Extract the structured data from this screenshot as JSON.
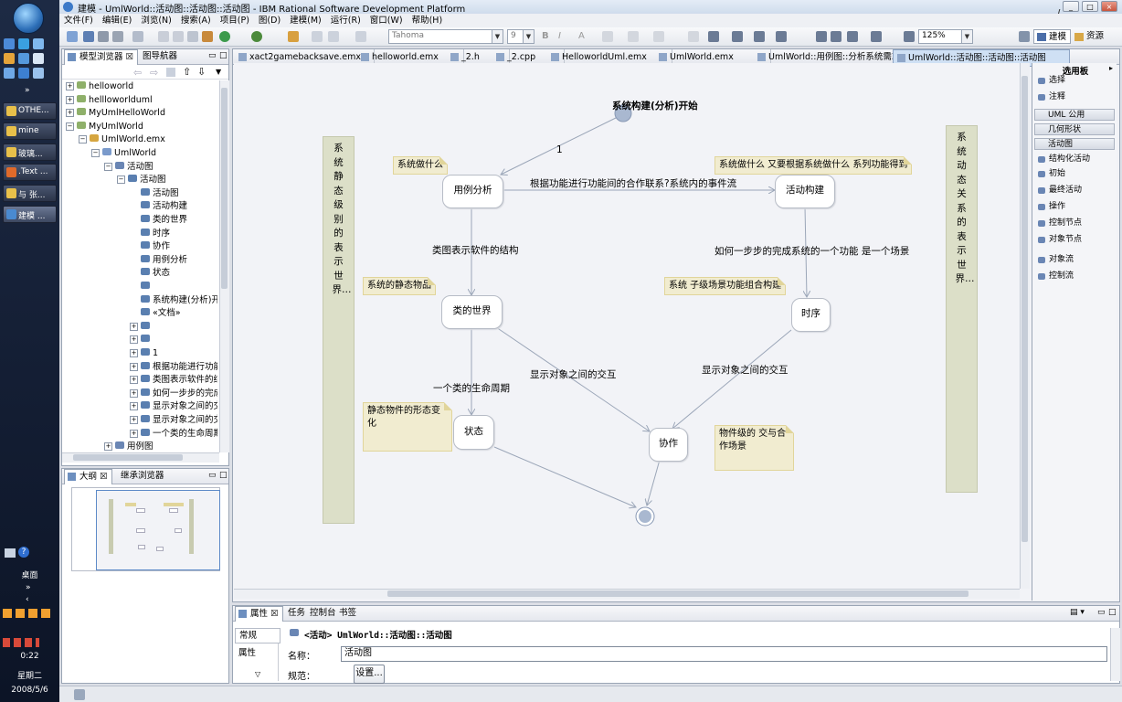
{
  "window": {
    "title": "建模 - UmlWorld::活动图::活动图::活动图 - IBM Rational Software Development Platform",
    "controls": [
      "_",
      "□",
      "×"
    ]
  },
  "menu": [
    "文件(F)",
    "编辑(E)",
    "浏览(N)",
    "搜索(A)",
    "项目(P)",
    "图(D)",
    "建模(M)",
    "运行(R)",
    "窗口(W)",
    "帮助(H)"
  ],
  "toolbar": {
    "font": "Tahoma",
    "size": "9",
    "bold": "B",
    "italic": "I",
    "font_color": "A",
    "zoom": "125%",
    "perspectives": [
      "建模",
      "资源"
    ]
  },
  "taskbar": {
    "items": [
      "OTHE...",
      "mine",
      "玻璃...",
      ".Text ...",
      "与 张...",
      "建模 ..."
    ],
    "desktop": "桌面",
    "time": "0:22",
    "weekday": "星期二",
    "date": "2008/5/6"
  },
  "model_explorer": {
    "tabs": [
      "模型浏览器",
      "图导航器"
    ],
    "tree": [
      {
        "label": "helloworld",
        "indent": 0,
        "exp": "+"
      },
      {
        "label": "hellloworlduml",
        "indent": 0,
        "exp": "+"
      },
      {
        "label": "MyUmlHelloWorld",
        "indent": 0,
        "exp": "+"
      },
      {
        "label": "MyUmlWorld",
        "indent": 0,
        "exp": "−"
      },
      {
        "label": "UmlWorld.emx",
        "indent": 1,
        "exp": "−"
      },
      {
        "label": "UmlWorld",
        "indent": 2,
        "exp": "−"
      },
      {
        "label": "活动图",
        "indent": 3,
        "exp": "−"
      },
      {
        "label": "活动图",
        "indent": 4,
        "exp": "−"
      },
      {
        "label": "活动图",
        "indent": 5,
        "exp": ""
      },
      {
        "label": "活动构建",
        "indent": 5,
        "exp": ""
      },
      {
        "label": "类的世界",
        "indent": 5,
        "exp": ""
      },
      {
        "label": "时序",
        "indent": 5,
        "exp": ""
      },
      {
        "label": "协作",
        "indent": 5,
        "exp": ""
      },
      {
        "label": "用例分析",
        "indent": 5,
        "exp": ""
      },
      {
        "label": "状态",
        "indent": 5,
        "exp": ""
      },
      {
        "label": "",
        "indent": 5,
        "exp": ""
      },
      {
        "label": "系统构建(分析)开",
        "indent": 5,
        "exp": ""
      },
      {
        "label": "«文档»",
        "indent": 5,
        "exp": ""
      },
      {
        "label": "",
        "indent": 5,
        "exp": "+"
      },
      {
        "label": "",
        "indent": 5,
        "exp": "+"
      },
      {
        "label": "1",
        "indent": 5,
        "exp": "+"
      },
      {
        "label": "根据功能进行功能",
        "indent": 5,
        "exp": "+"
      },
      {
        "label": "类图表示软件的结",
        "indent": 5,
        "exp": "+"
      },
      {
        "label": "如何一步步的完成",
        "indent": 5,
        "exp": "+"
      },
      {
        "label": "显示对象之间的交",
        "indent": 5,
        "exp": "+"
      },
      {
        "label": "显示对象之间的交",
        "indent": 5,
        "exp": "+"
      },
      {
        "label": "一个类的生命周期",
        "indent": 5,
        "exp": "+"
      },
      {
        "label": "用例图",
        "indent": 3,
        "exp": "+"
      }
    ]
  },
  "outline": {
    "tabs": [
      "大纲",
      "继承浏览器"
    ]
  },
  "editor": {
    "tabs": [
      "xact2gamebacksave.emx",
      "helloworld.emx",
      "_2.h",
      "_2.cpp",
      "HelloworldUml.emx",
      "UmlWorld.emx",
      "UmlWorld::用例图::分析系统需求",
      "UmlWorld::活动图::活动图::活动图"
    ],
    "selected_tab": 7
  },
  "diagram": {
    "start_label": "系统构建(分析)开始",
    "multiplicity": "1",
    "activities": {
      "usecase": "用例分析",
      "build": "活动构建",
      "classes": "类的世界",
      "sequence": "时序",
      "state": "状态",
      "collab": "协作"
    },
    "notes": {
      "what": "系统做什么",
      "how": "系统做什么 又要根据系统做什么 系列功能得到",
      "static_items": "系统的静态物品",
      "subsystem": "系统 子级场景功能组合构建",
      "static_change": "静态物件的形态变化",
      "object_level": "物件级的 交与合作场景",
      "static_world": "系统静态级别的表示世界…",
      "dynamic_world": "系统动态关系的表示世界…"
    },
    "labels": {
      "func_link": "根据功能进行功能间的合作联系?系统内的事件流",
      "class_struct": "类图表示软件的结构",
      "step_by_step": "如何一步步的完成系统的一个功能 是一个场景",
      "interaction_left": "显示对象之间的交互",
      "interaction_right": "显示对象之间的交互",
      "lifecycle": "一个类的生命周期"
    }
  },
  "palette": {
    "title": "选用板",
    "items": [
      {
        "label": "选择",
        "type": "item"
      },
      {
        "label": "注释",
        "type": "item"
      },
      {
        "label": "UML 公用",
        "type": "header"
      },
      {
        "label": "几何形状",
        "type": "header"
      },
      {
        "label": "活动图",
        "type": "header"
      },
      {
        "label": "结构化活动",
        "type": "item"
      },
      {
        "label": "初始",
        "type": "item"
      },
      {
        "label": "最终活动",
        "type": "item"
      },
      {
        "label": "操作",
        "type": "item"
      },
      {
        "label": "控制节点",
        "type": "item"
      },
      {
        "label": "对象节点",
        "type": "item"
      },
      {
        "label": "对象流",
        "type": "item"
      },
      {
        "label": "控制流",
        "type": "item"
      }
    ]
  },
  "properties": {
    "tabs": [
      "属性",
      "任务",
      "控制台",
      "书签"
    ],
    "side_tabs": [
      "常规",
      "属性"
    ],
    "header": "<活动> UmlWorld::活动图::活动图",
    "name_label": "名称：",
    "name_value": "活动图",
    "spec_label": "规范：",
    "settings_button": "设置..."
  },
  "colors": {
    "accent": "#2f5fa8",
    "note_fill": "#f1ecd0",
    "canvas": "#f2f3f7"
  }
}
